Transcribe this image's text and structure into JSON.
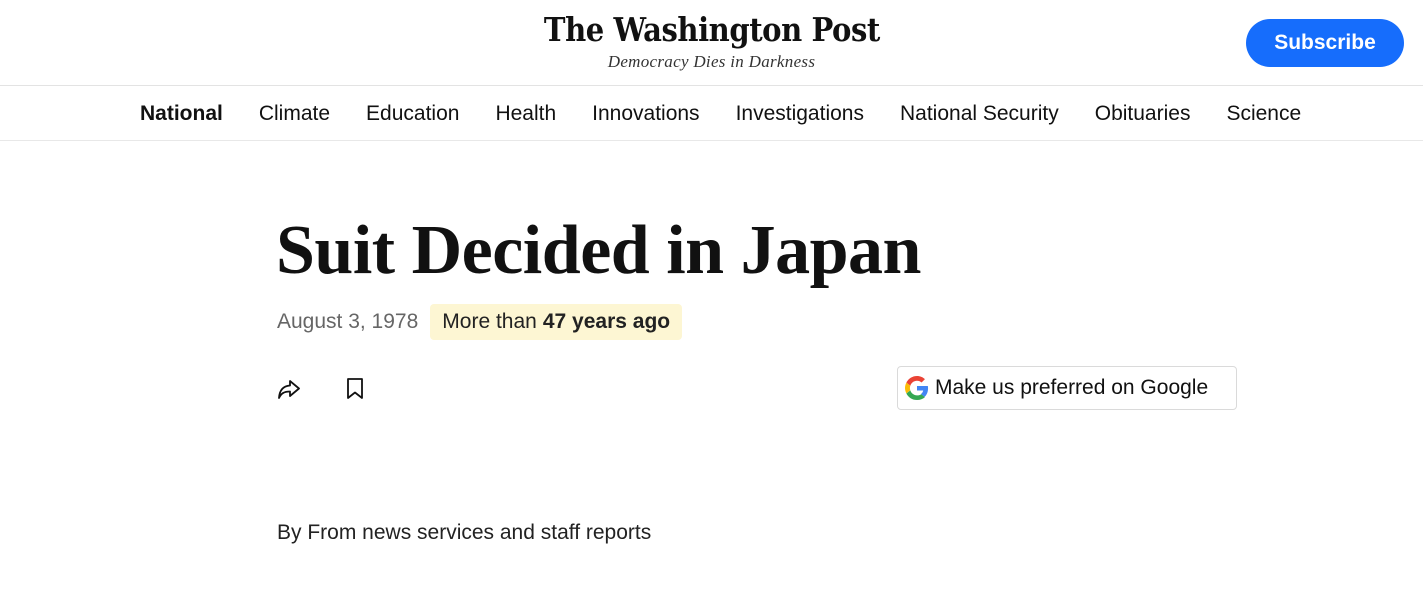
{
  "masthead": {
    "logo_text": "The Washington Post",
    "tagline": "Democracy Dies in Darkness",
    "subscribe_label": "Subscribe"
  },
  "nav": {
    "items": [
      {
        "label": "National",
        "active": true
      },
      {
        "label": "Climate"
      },
      {
        "label": "Education"
      },
      {
        "label": "Health"
      },
      {
        "label": "Innovations"
      },
      {
        "label": "Investigations"
      },
      {
        "label": "National Security"
      },
      {
        "label": "Obituaries"
      },
      {
        "label": "Science"
      }
    ]
  },
  "article": {
    "headline": "Suit Decided in Japan",
    "date": "August 3, 1978",
    "age_prefix": "More than",
    "age_value": "47 years ago",
    "byline": "By From news services and staff reports"
  },
  "actions": {
    "share_icon": "share-icon",
    "bookmark_icon": "bookmark-icon",
    "google_label": "Make us preferred on Google"
  },
  "colors": {
    "subscribe_bg": "#166dfc",
    "badge_bg": "#fdf6d3"
  }
}
